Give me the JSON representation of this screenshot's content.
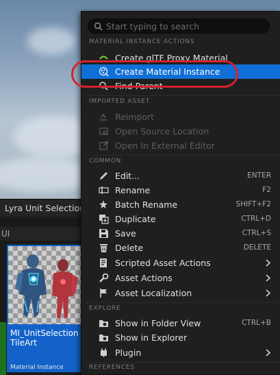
{
  "background": {
    "tab_title": "Lyra Unit Selection",
    "tab_more": "»",
    "path_label": "UI",
    "asset_tile": {
      "name": "MI_UnitSelectionTileArt",
      "type": "Material Instance"
    }
  },
  "menu": {
    "search_placeholder": "Start typing to search",
    "sections": {
      "material_instance_actions": "MATERIAL INSTANCE ACTIONS",
      "imported_asset": "IMPORTED ASSET",
      "common": "COMMON",
      "explore": "EXPLORE",
      "references": "REFERENCES"
    },
    "items": {
      "gltf_proxy": {
        "label": "Create glTF Proxy Material"
      },
      "material_instance": {
        "label": "Create Material Instance"
      },
      "find_parent": {
        "label": "Find Parent"
      },
      "reimport": {
        "label": "Reimport"
      },
      "open_source": {
        "label": "Open Source Location"
      },
      "open_external": {
        "label": "Open In External Editor"
      },
      "edit": {
        "label": "Edit...",
        "shortcut": "ENTER"
      },
      "rename": {
        "label": "Rename",
        "shortcut": "F2"
      },
      "batch_rename": {
        "label": "Batch Rename",
        "shortcut": "SHIFT+F2"
      },
      "duplicate": {
        "label": "Duplicate",
        "shortcut": "CTRL+D"
      },
      "save": {
        "label": "Save",
        "shortcut": "CTRL+S"
      },
      "delete": {
        "label": "Delete",
        "shortcut": "DELETE"
      },
      "scripted": {
        "label": "Scripted Asset Actions"
      },
      "asset_actions": {
        "label": "Asset Actions"
      },
      "asset_localization": {
        "label": "Asset Localization"
      },
      "show_folder": {
        "label": "Show in Folder View",
        "shortcut": "CTRL+B"
      },
      "show_explorer": {
        "label": "Show in Explorer"
      },
      "plugin": {
        "label": "Plugin"
      }
    }
  },
  "colors": {
    "highlight": "#0f6fd6",
    "annotation_circle": "#d4232e"
  }
}
